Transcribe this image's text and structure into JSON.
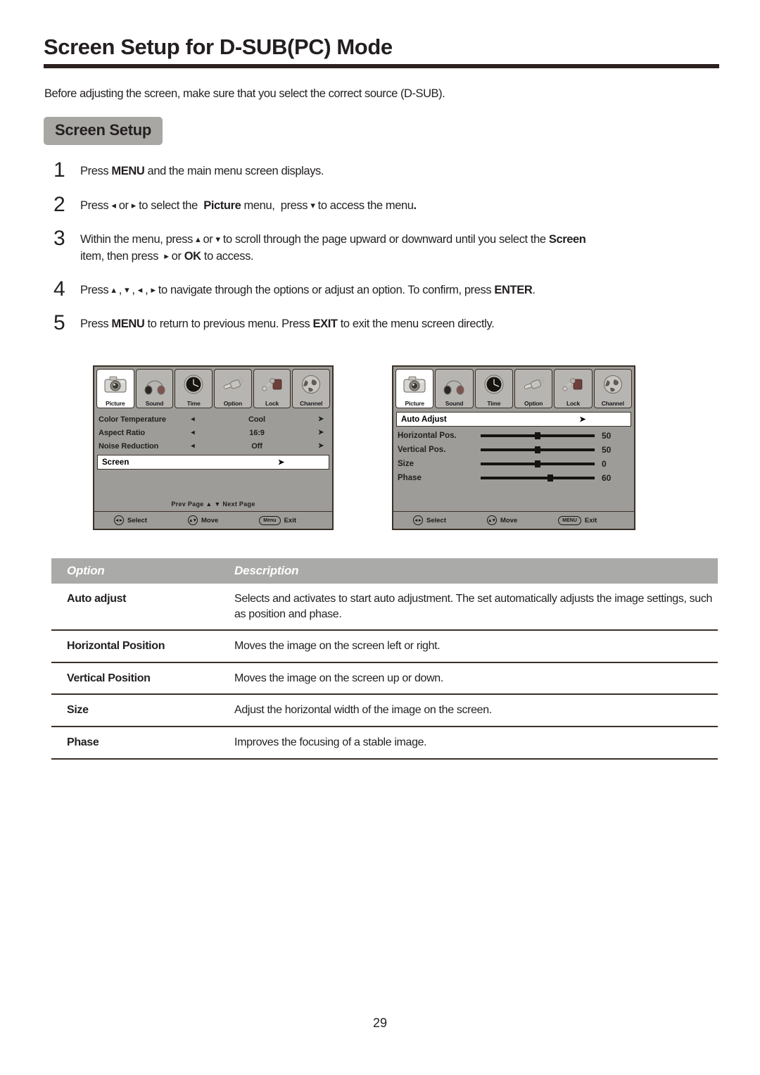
{
  "document": {
    "title": "Screen Setup for D-SUB(PC) Mode",
    "intro": "Before adjusting the screen, make sure that you select the correct source (D-SUB).",
    "section_badge": "Screen Setup",
    "page_number": "29"
  },
  "steps": [
    {
      "num": "1",
      "html": "Press <b>MENU</b> and the main menu screen displays."
    },
    {
      "num": "2",
      "html": "Press <span class=\"arrow-gl\">◂</span> or <span class=\"arrow-gl\">▸</span> to select the&nbsp; <b>Picture</b> menu,&nbsp; press <span class=\"arrow-gl\">▾</span> to access the menu<b>.</b>"
    },
    {
      "num": "3",
      "html": "Within the menu, press <span class=\"arrow-gl\">▴</span> or <span class=\"arrow-gl\">▾</span> to scroll through the page upward or downward until you select the <b>Screen</b><br>item, then press&nbsp; <span class=\"arrow-gl\">▸</span> or <b>OK</b> to access."
    },
    {
      "num": "4",
      "html": "Press <span class=\"arrow-gl\">▴</span> , <span class=\"arrow-gl\">▾</span> , <span class=\"arrow-gl\">◂</span> , <span class=\"arrow-gl\">▸</span> to navigate through the options or adjust an option. To confirm, press <b>ENTER</b>."
    },
    {
      "num": "5",
      "html": "Press <b>MENU</b> to return to previous menu. Press <b>EXIT</b> to exit the menu screen directly."
    }
  ],
  "osd_tabs": [
    {
      "label": "Picture",
      "icon": "camera-icon",
      "active": true
    },
    {
      "label": "Sound",
      "icon": "headphones-icon",
      "active": false
    },
    {
      "label": "Time",
      "icon": "clock-icon",
      "active": false
    },
    {
      "label": "Option",
      "icon": "connector-icon",
      "active": false
    },
    {
      "label": "Lock",
      "icon": "padlock-icon",
      "active": false
    },
    {
      "label": "Channel",
      "icon": "globe-icon",
      "active": false
    }
  ],
  "osd_left": {
    "rows": [
      {
        "label": "Color Temperature",
        "left_arrow": "◂",
        "value": "Cool",
        "right_arrow": "➤"
      },
      {
        "label": "Aspect Ratio",
        "left_arrow": "◂",
        "value": "16:9",
        "right_arrow": "➤"
      },
      {
        "label": "Noise Reduction",
        "left_arrow": "◂",
        "value": "Off",
        "right_arrow": "➤"
      }
    ],
    "highlight": {
      "label": "Screen",
      "arrow": "➤"
    },
    "page_hint": "Prev  Page ▲   ▼  Next  Page",
    "footer": {
      "select_keys": "◂ ▸",
      "select_label": "Select",
      "move_keys": "▴ ▾",
      "move_label": "Move",
      "exit_key": "Menu",
      "exit_label": "Exit"
    }
  },
  "osd_right": {
    "highlight": {
      "label": "Auto Adjust",
      "arrow": "➤"
    },
    "sliders": [
      {
        "label": "Horizontal Pos.",
        "value": "50",
        "percent": 50
      },
      {
        "label": "Vertical Pos.",
        "value": "50",
        "percent": 50
      },
      {
        "label": "Size",
        "value": "0",
        "percent": 50
      },
      {
        "label": "Phase",
        "value": "60",
        "percent": 61
      }
    ],
    "footer": {
      "select_keys": "◂ ▸",
      "select_label": "Select",
      "move_keys": "▴ ▾",
      "move_label": "Move",
      "exit_key": "MENU",
      "exit_label": "Exit"
    }
  },
  "table": {
    "headers": [
      "Option",
      "Description"
    ],
    "rows": [
      {
        "option": "Auto adjust",
        "description": "Selects and activates to start auto adjustment. The set automatically adjusts the image settings, such as position and phase."
      },
      {
        "option": "Horizontal Position",
        "description": "Moves the image on the screen left or right."
      },
      {
        "option": "Vertical Position",
        "description": "Moves the image on the screen up or down."
      },
      {
        "option": "Size",
        "description": "Adjust the horizontal width of the image on the screen."
      },
      {
        "option": "Phase",
        "description": "Improves the focusing of a stable image."
      }
    ]
  },
  "colors": {
    "rule": "#2c211f",
    "badge_bg": "#a9a7a3",
    "osd_bg": "#9d9c98",
    "osd_border": "#3b3028",
    "table_header_bg": "#aaaaa8"
  }
}
